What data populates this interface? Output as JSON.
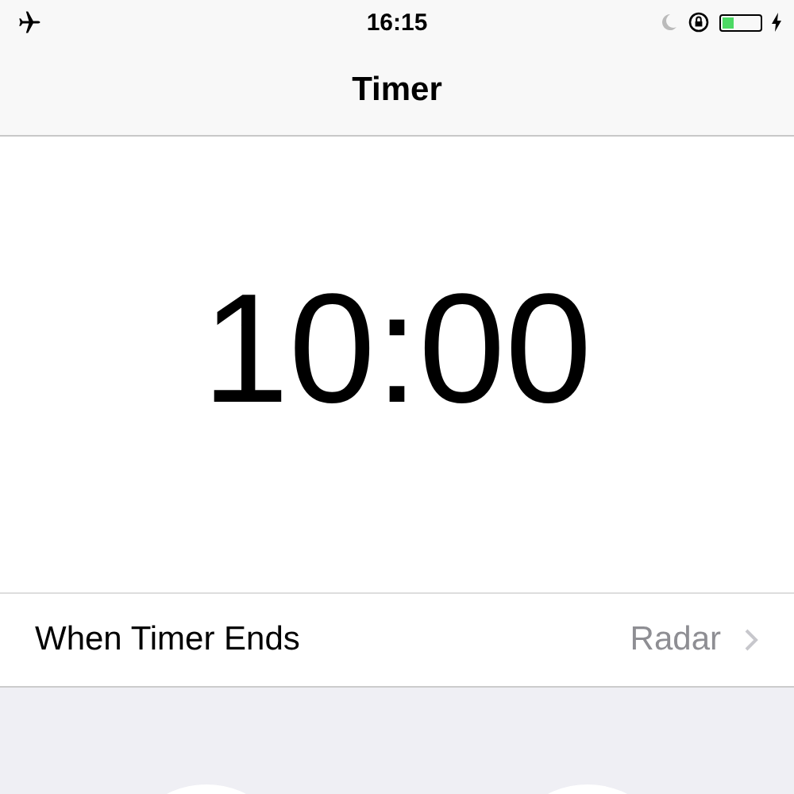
{
  "status_bar": {
    "time": "16:15",
    "battery": {
      "level": 0.3,
      "charging": true
    }
  },
  "nav": {
    "title": "Timer"
  },
  "timer": {
    "display": "10:00"
  },
  "settings": [
    {
      "label": "When Timer Ends",
      "value": "Radar"
    }
  ]
}
